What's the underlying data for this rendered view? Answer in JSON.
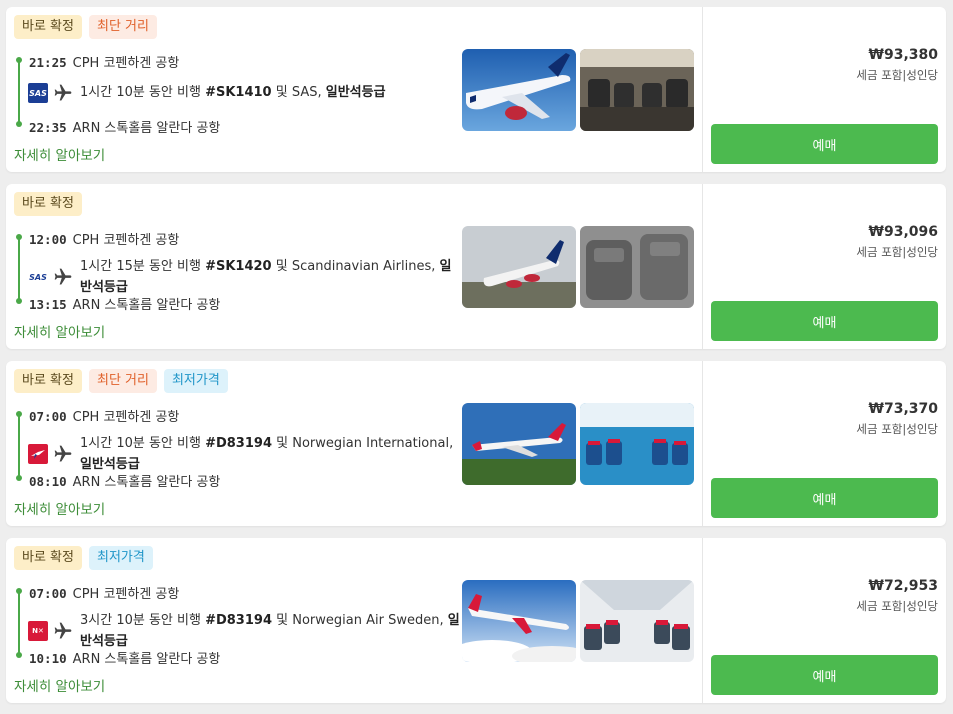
{
  "flights": [
    {
      "badges": [
        {
          "label": "바로 확정",
          "type": "instant"
        },
        {
          "label": "최단 거리",
          "type": "shortest"
        }
      ],
      "depart": {
        "time": "21:25",
        "airport": "CPH 코펜하겐 공항"
      },
      "arrive": {
        "time": "22:35",
        "airport": "ARN 스톡홀름 알란다 공항"
      },
      "airline_logo": "SAS",
      "airline_logo_color": "#1b3e95",
      "duration": "1시간 10분 동안 비행",
      "flight_no": "#SK1410",
      "joiner": "및",
      "carrier": "SAS,",
      "cabin": "일반석등급",
      "details": "자세히 알아보기",
      "price": "₩93,380",
      "price_note": "세금 포함|성인당",
      "book": "예매",
      "photo_theme": "sas"
    },
    {
      "badges": [
        {
          "label": "바로 확정",
          "type": "instant"
        }
      ],
      "depart": {
        "time": "12:00",
        "airport": "CPH 코펜하겐 공항"
      },
      "arrive": {
        "time": "13:15",
        "airport": "ARN 스톡홀름 알란다 공항"
      },
      "airline_logo": "SAS",
      "airline_logo_color": "#ffffff",
      "duration": "1시간 15분 동안 비행",
      "flight_no": "#SK1420",
      "joiner": "및",
      "carrier": "Scandinavian Airlines,",
      "cabin": "일반석등급",
      "details": "자세히 알아보기",
      "price": "₩93,096",
      "price_note": "세금 포함|성인당",
      "book": "예매",
      "photo_theme": "sas2"
    },
    {
      "badges": [
        {
          "label": "바로 확정",
          "type": "instant"
        },
        {
          "label": "최단 거리",
          "type": "shortest"
        },
        {
          "label": "최저가격",
          "type": "cheapest"
        }
      ],
      "depart": {
        "time": "07:00",
        "airport": "CPH 코펜하겐 공항"
      },
      "arrive": {
        "time": "08:10",
        "airport": "ARN 스톡홀름 알란다 공항"
      },
      "airline_logo": "norwegian",
      "airline_logo_color": "#d81939",
      "duration": "1시간 10분 동안 비행",
      "flight_no": "#D83194",
      "joiner": "및",
      "carrier": "Norwegian International,",
      "cabin": "일반석등급",
      "details": "자세히 알아보기",
      "price": "₩73,370",
      "price_note": "세금 포함|성인당",
      "book": "예매",
      "photo_theme": "norwegian"
    },
    {
      "badges": [
        {
          "label": "바로 확정",
          "type": "instant"
        },
        {
          "label": "최저가격",
          "type": "cheapest"
        }
      ],
      "depart": {
        "time": "07:00",
        "airport": "CPH 코펜하겐 공항"
      },
      "arrive": {
        "time": "10:10",
        "airport": "ARN 스톡홀름 알란다 공항"
      },
      "airline_logo": "nax",
      "airline_logo_color": "#d81939",
      "duration": "3시간 10분 동안 비행",
      "flight_no": "#D83194",
      "joiner": "및",
      "carrier": "Norwegian Air Sweden,",
      "cabin": "일반석등급",
      "details": "자세히 알아보기",
      "price": "₩72,953",
      "price_note": "세금 포함|성인당",
      "book": "예매",
      "photo_theme": "norwegian2"
    }
  ]
}
